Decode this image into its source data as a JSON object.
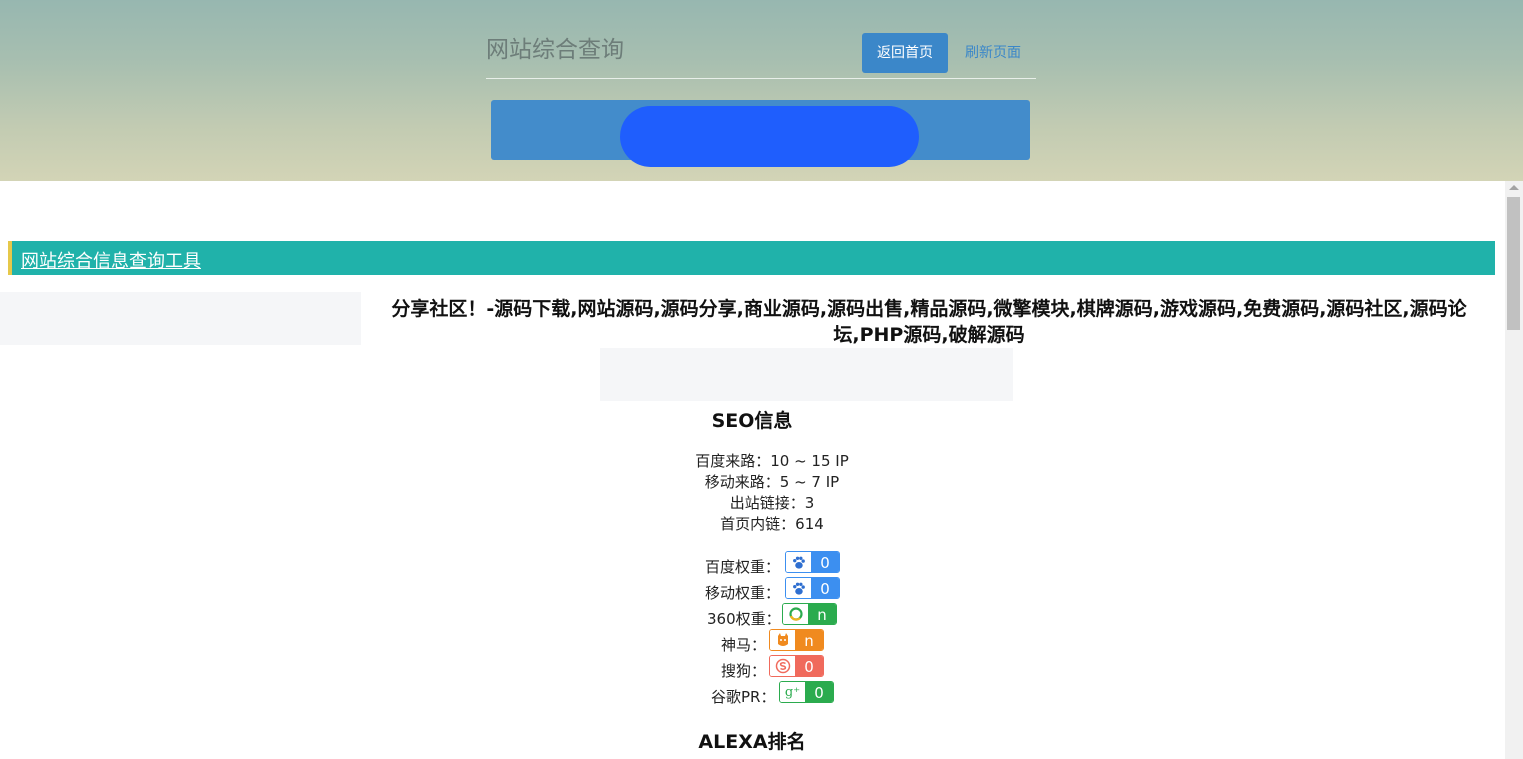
{
  "header": {
    "site_title": "网站综合查询",
    "home_button": "返回首页",
    "refresh_link": "刷新页面"
  },
  "tool_bar": {
    "title": "网站综合信息查询工具"
  },
  "site": {
    "description": "分享社区！-源码下载,网站源码,源码分享,商业源码,源码出售,精品源码,微擎模块,棋牌源码,游戏源码,免费源码,源码社区,源码论坛,PHP源码,破解源码"
  },
  "seo": {
    "heading": "SEO信息",
    "stats": [
      "百度来路：10 ~ 15 IP",
      "移动来路：5 ~ 7 IP",
      "出站链接：3",
      "首页内链：614"
    ],
    "weights": [
      {
        "label": "百度权重：",
        "value": "0",
        "icon": "baidu-paw-icon",
        "color": "#3c8ff0"
      },
      {
        "label": "移动权重：",
        "value": "0",
        "icon": "baidu-paw-icon",
        "color": "#3c8ff0"
      },
      {
        "label": "360权重：",
        "value": "n",
        "icon": "360-ring-icon",
        "color": "#2bab4e"
      },
      {
        "label": "神马：",
        "value": "n",
        "icon": "shenma-icon",
        "color": "#f08a1f"
      },
      {
        "label": "搜狗：",
        "value": "0",
        "icon": "sogou-icon",
        "color": "#f06a5c"
      },
      {
        "label": "谷歌PR：",
        "value": "0",
        "icon": "google-plus-icon",
        "color": "#2bab4e"
      }
    ]
  },
  "alexa": {
    "heading": "ALEXA排名"
  }
}
